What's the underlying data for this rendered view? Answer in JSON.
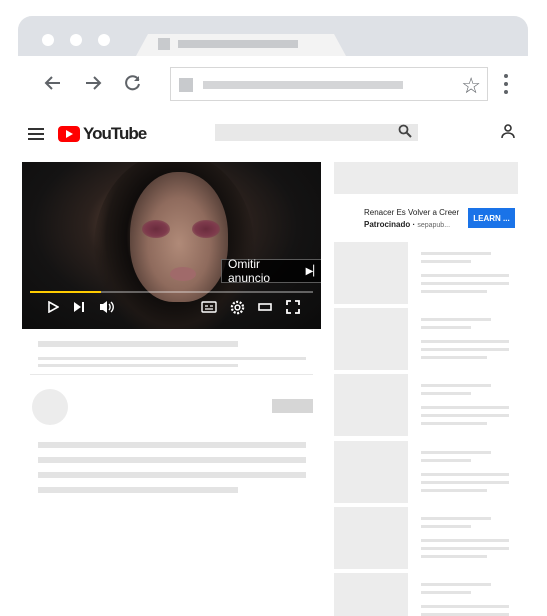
{
  "browser": {
    "icons": {
      "back": "arrow-left-icon",
      "forward": "arrow-right-icon",
      "reload": "reload-icon",
      "bookmark": "star-icon",
      "menu": "kebab-menu-icon"
    }
  },
  "youtube": {
    "logo_text": "YouTube",
    "icons": {
      "menu": "hamburger-icon",
      "search": "search-icon",
      "account": "account-icon"
    }
  },
  "player": {
    "skip_label": "Omitir anuncio",
    "progress": 0.25,
    "progress_color": "#ffcc00",
    "controls": [
      "play-icon",
      "next-icon",
      "volume-icon",
      "captions-icon",
      "settings-icon",
      "theater-icon",
      "fullscreen-icon"
    ]
  },
  "ad": {
    "title": "Renacer Es Volver a Creer",
    "sponsored": "Patrocinado",
    "domain": "sepapub...",
    "cta": "LEARN ..."
  },
  "colors": {
    "accent": "#1a73e8",
    "youtube_red": "#ff0000"
  }
}
